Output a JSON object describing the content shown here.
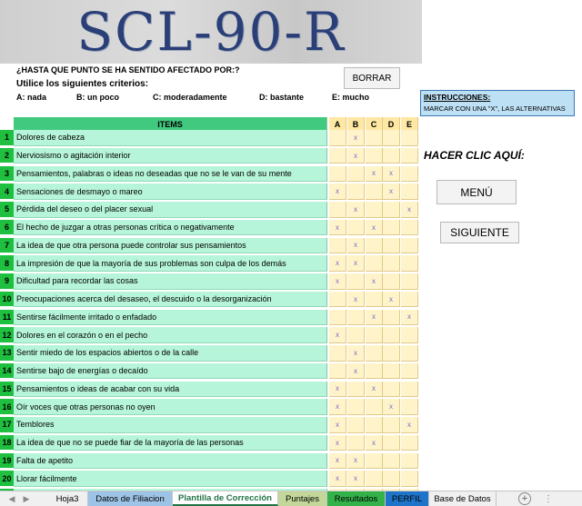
{
  "banner": {
    "title": "SCL-90-R"
  },
  "header": {
    "question": "¿HASTA QUE PUNTO SE HA SENTIDO AFECTADO POR:?",
    "criteria_intro": "Utilice los siguientes criterios:",
    "criteria": [
      {
        "label": "A: nada"
      },
      {
        "label": "B: un poco"
      },
      {
        "label": "C: moderadamente"
      },
      {
        "label": "D: bastante"
      },
      {
        "label": "E: mucho"
      }
    ],
    "clear_button": "BORRAR"
  },
  "instructions": {
    "title": "INSTRUCCIONES:",
    "text": "MARCAR CON UNA \"X\", LAS ALTERNATIVAS"
  },
  "table": {
    "header_items": "ITEMS",
    "col_a": "A",
    "col_b": "B",
    "col_c": "C",
    "col_d": "D",
    "col_e": "E",
    "rows": [
      {
        "n": "1",
        "text": "Dolores de cabeza",
        "a": "",
        "b": "x",
        "c": "",
        "d": "",
        "e": ""
      },
      {
        "n": "2",
        "text": "Nerviosismo o agitación interior",
        "a": "",
        "b": "x",
        "c": "",
        "d": "",
        "e": ""
      },
      {
        "n": "3",
        "text": "Pensamientos, palabras o ideas no deseadas que no se le van de su mente",
        "a": "",
        "b": "",
        "c": "x",
        "d": "x",
        "e": ""
      },
      {
        "n": "4",
        "text": "Sensaciones de desmayo o mareo",
        "a": "x",
        "b": "",
        "c": "",
        "d": "x",
        "e": ""
      },
      {
        "n": "5",
        "text": "Pérdida del deseo o del placer sexual",
        "a": "",
        "b": "x",
        "c": "",
        "d": "",
        "e": "x"
      },
      {
        "n": "6",
        "text": "El hecho de juzgar a otras personas crítica o negativamente",
        "a": "x",
        "b": "",
        "c": "x",
        "d": "",
        "e": ""
      },
      {
        "n": "7",
        "text": " La idea de que otra persona puede controlar sus pensamientos",
        "a": "",
        "b": "x",
        "c": "",
        "d": "",
        "e": ""
      },
      {
        "n": "8",
        "text": " La impresión de que la mayoría de sus problemas son culpa de los demás",
        "a": "x",
        "b": "x",
        "c": "",
        "d": "",
        "e": ""
      },
      {
        "n": "9",
        "text": "Dificultad para recordar las cosas",
        "a": "x",
        "b": "",
        "c": "x",
        "d": "",
        "e": ""
      },
      {
        "n": "10",
        "text": "Preocupaciones acerca del desaseo, el descuido o la desorganización",
        "a": "",
        "b": "x",
        "c": "",
        "d": "x",
        "e": ""
      },
      {
        "n": "11",
        "text": "Sentirse fácilmente irritado o enfadado",
        "a": "",
        "b": "",
        "c": "x",
        "d": "",
        "e": "x"
      },
      {
        "n": "12",
        "text": "Dolores en el corazón o en el pecho",
        "a": "x",
        "b": "",
        "c": "",
        "d": "",
        "e": ""
      },
      {
        "n": "13",
        "text": "Sentir miedo de los espacios abiertos o de la calle",
        "a": "",
        "b": "x",
        "c": "",
        "d": "",
        "e": ""
      },
      {
        "n": "14",
        "text": "Sentirse bajo de energías o decaído",
        "a": "",
        "b": "x",
        "c": "",
        "d": "",
        "e": ""
      },
      {
        "n": "15",
        "text": "Pensamientos o ideas de acabar con su vida",
        "a": "x",
        "b": "",
        "c": "x",
        "d": "",
        "e": ""
      },
      {
        "n": "16",
        "text": "Oír voces que otras personas no oyen",
        "a": "x",
        "b": "",
        "c": "",
        "d": "x",
        "e": ""
      },
      {
        "n": "17",
        "text": "Temblores",
        "a": "x",
        "b": "",
        "c": "",
        "d": "",
        "e": "x"
      },
      {
        "n": "18",
        "text": "La idea de que no se puede fiar de la mayoría de las personas",
        "a": "x",
        "b": "",
        "c": "x",
        "d": "",
        "e": ""
      },
      {
        "n": "19",
        "text": "Falta de apetito",
        "a": "x",
        "b": "x",
        "c": "",
        "d": "",
        "e": ""
      },
      {
        "n": "20",
        "text": "Llorar fácilmente",
        "a": "x",
        "b": "x",
        "c": "",
        "d": "",
        "e": ""
      },
      {
        "n": "21",
        "text": "Timidez o incomodidad con el sexo opuesto",
        "a": "x",
        "b": "",
        "c": "x",
        "d": "",
        "e": ""
      }
    ]
  },
  "side": {
    "click_here": "HACER CLIC AQUÍ:",
    "menu_button": "MENÚ",
    "next_button": "SIGUIENTE"
  },
  "tabs": [
    {
      "label": "Hoja3",
      "color": "#f0f0f0",
      "active": false
    },
    {
      "label": "Datos de Filiacion",
      "color": "#9dc3e6",
      "active": false
    },
    {
      "label": "Plantilla de Corrección",
      "color": "#ffffff",
      "active": true
    },
    {
      "label": "Puntajes",
      "color": "#c4d79b",
      "active": false
    },
    {
      "label": "Resultados",
      "color": "#33b24a",
      "active": false
    },
    {
      "label": "PERFIL",
      "color": "#1e74c9",
      "active": false
    },
    {
      "label": "Base de Datos",
      "color": "#f0f0f0",
      "active": false
    }
  ],
  "tab_controls": {
    "plus": "+",
    "more": "⋮"
  }
}
